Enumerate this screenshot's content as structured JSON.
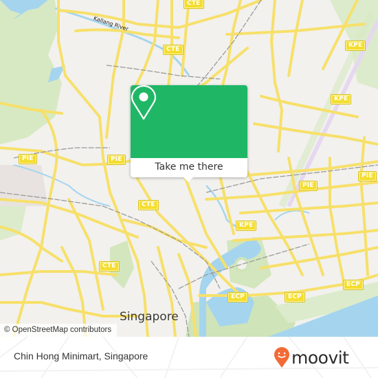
{
  "map": {
    "river_label": "Kallang River",
    "city_label": "Singapore",
    "attribution": "© OpenStreetMap contributors",
    "highway_shields": [
      {
        "name": "CTE",
        "id": "cte-1"
      },
      {
        "name": "CTE",
        "id": "cte-2"
      },
      {
        "name": "CTE",
        "id": "cte-3"
      },
      {
        "name": "CTE",
        "id": "cte-4"
      },
      {
        "name": "KPE",
        "id": "kpe-1"
      },
      {
        "name": "KPE",
        "id": "kpe-2"
      },
      {
        "name": "KPE",
        "id": "kpe-3"
      },
      {
        "name": "PIE",
        "id": "pie-1"
      },
      {
        "name": "PIE",
        "id": "pie-2"
      },
      {
        "name": "PIE",
        "id": "pie-3"
      },
      {
        "name": "PIE",
        "id": "pie-4"
      },
      {
        "name": "ECP",
        "id": "ecp-1"
      },
      {
        "name": "ECP",
        "id": "ecp-2"
      },
      {
        "name": "ECP",
        "id": "ecp-3"
      }
    ],
    "colors": {
      "land": "#f2f1ee",
      "park": "#d5e8c0",
      "water": "#a5d5ee",
      "road": "#f7e06a",
      "rail": "#9a9a9a"
    }
  },
  "popup": {
    "icon": "map-pin-icon",
    "button_label": "Take me there",
    "color": "#1fb766"
  },
  "footer": {
    "place_name": "Chin Hong Minimart, Singapore",
    "brand": "moovit",
    "brand_color": "#f26a35"
  }
}
